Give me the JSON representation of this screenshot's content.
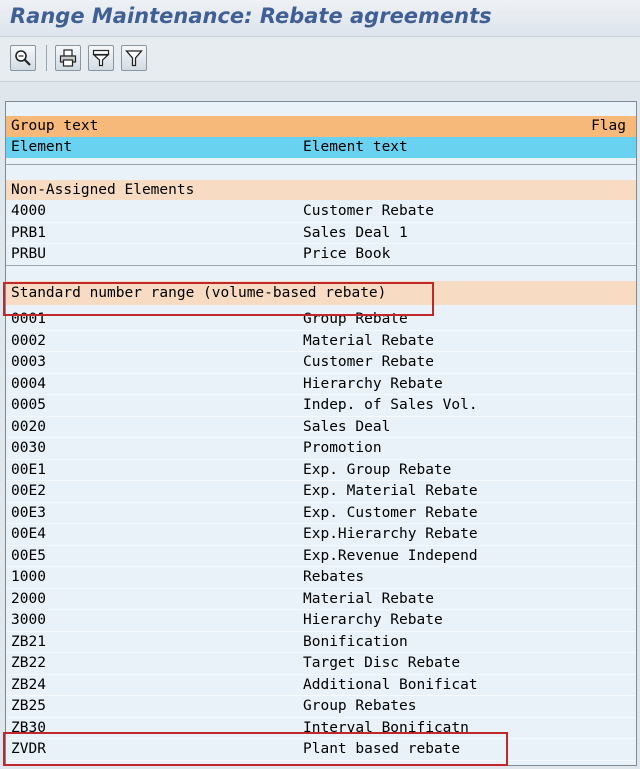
{
  "window": {
    "title": "Range Maintenance: Rebate agreements"
  },
  "toolbar": {
    "buttons": [
      {
        "icon": "zoom-icon"
      },
      {
        "icon": "print-icon"
      },
      {
        "icon": "filter-set-icon"
      },
      {
        "icon": "filter-icon"
      }
    ]
  },
  "table": {
    "header_group_text": "Group text",
    "header_flag": "Flag",
    "header_element": "Element",
    "header_element_text": "Element text",
    "groups": [
      {
        "title": "Non-Assigned Elements",
        "rows": [
          {
            "element": "4000",
            "text": "Customer Rebate"
          },
          {
            "element": "PRB1",
            "text": "Sales Deal 1"
          },
          {
            "element": "PRBU",
            "text": "Price Book"
          }
        ]
      },
      {
        "title": "Standard number range (volume-based rebate)",
        "rows": [
          {
            "element": "0001",
            "text": "Group Rebate"
          },
          {
            "element": "0002",
            "text": "Material Rebate"
          },
          {
            "element": "0003",
            "text": "Customer Rebate"
          },
          {
            "element": "0004",
            "text": "Hierarchy Rebate"
          },
          {
            "element": "0005",
            "text": "Indep. of Sales Vol."
          },
          {
            "element": "0020",
            "text": "Sales Deal"
          },
          {
            "element": "0030",
            "text": "Promotion"
          },
          {
            "element": "00E1",
            "text": "Exp. Group Rebate"
          },
          {
            "element": "00E2",
            "text": "Exp. Material Rebate"
          },
          {
            "element": "00E3",
            "text": "Exp. Customer Rebate"
          },
          {
            "element": "00E4",
            "text": "Exp.Hierarchy Rebate"
          },
          {
            "element": "00E5",
            "text": "Exp.Revenue Independ"
          },
          {
            "element": "1000",
            "text": "Rebates"
          },
          {
            "element": "2000",
            "text": "Material Rebate"
          },
          {
            "element": "3000",
            "text": "Hierarchy Rebate"
          },
          {
            "element": "ZB21",
            "text": "Bonification"
          },
          {
            "element": "ZB22",
            "text": "Target Disc Rebate"
          },
          {
            "element": "ZB24",
            "text": "Additional Bonificat"
          },
          {
            "element": "ZB25",
            "text": "Group Rebates"
          },
          {
            "element": "ZB30",
            "text": "Interval Bonificatn"
          },
          {
            "element": "ZVDR",
            "text": "Plant based rebate"
          }
        ]
      }
    ]
  },
  "colors": {
    "title": "#3f5f95",
    "header_orange": "#f7b97a",
    "header_blue": "#6ad2f1",
    "group_peach": "#f7dcc3",
    "highlight_red": "#c0292b"
  }
}
